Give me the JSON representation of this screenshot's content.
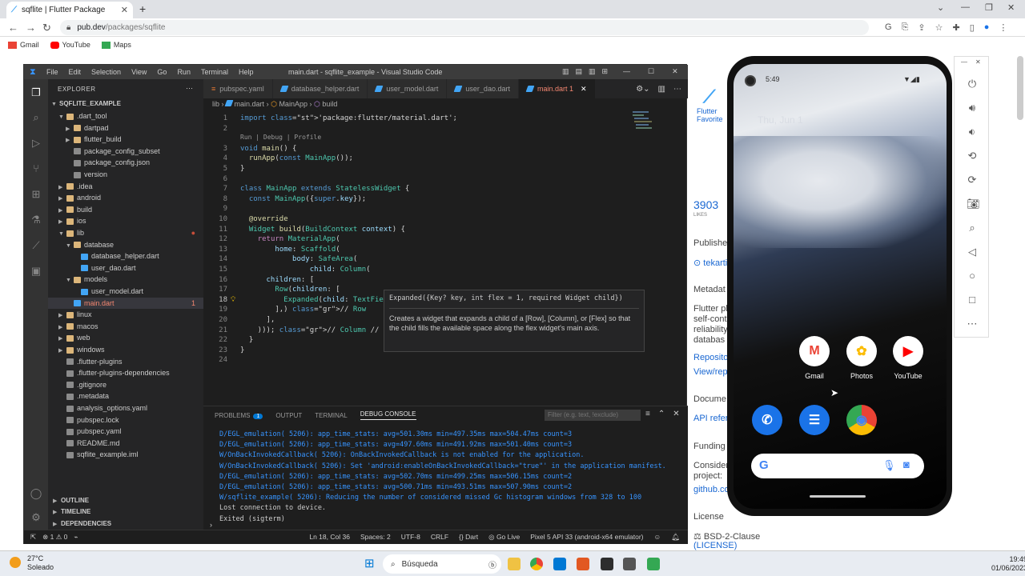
{
  "browser": {
    "tab_title": "sqflite | Flutter Package",
    "url_domain": "pub.dev",
    "url_path": "/packages/sqflite",
    "bookmarks": [
      "Gmail",
      "YouTube",
      "Maps"
    ]
  },
  "webpage": {
    "flutter_badge": "Flutter Favorite",
    "likes_count": "3903",
    "likes_label": "LIKES",
    "publisher_label": "Publishe",
    "publisher_value": "tekarti",
    "metadata_label": "Metadat",
    "desc_lines": [
      "Flutter pl",
      "self-cont",
      "reliability",
      "databas"
    ],
    "repo_link": "Reposito",
    "view_link": "View/rep",
    "docs_label": "Docume",
    "api_link": "API refer",
    "funding_label": "Funding",
    "consider_lines": [
      "Consider",
      "project:"
    ],
    "github_link": "github.co",
    "license_label": "License",
    "license_value": "BSD-2-Clause",
    "license_link": "(LICENSE)"
  },
  "vscode": {
    "menu": [
      "File",
      "Edit",
      "Selection",
      "View",
      "Go",
      "Run",
      "Terminal",
      "Help"
    ],
    "title": "main.dart - sqflite_example - Visual Studio Code",
    "explorer_label": "EXPLORER",
    "root_folder": "SQFLITE_EXAMPLE",
    "tree": [
      {
        "label": ".dart_tool",
        "depth": 1,
        "type": "folder-open"
      },
      {
        "label": "dartpad",
        "depth": 2,
        "type": "folder"
      },
      {
        "label": "flutter_build",
        "depth": 2,
        "type": "folder"
      },
      {
        "label": "package_config_subset",
        "depth": 2,
        "type": "file"
      },
      {
        "label": "package_config.json",
        "depth": 2,
        "type": "file"
      },
      {
        "label": "version",
        "depth": 2,
        "type": "file"
      },
      {
        "label": ".idea",
        "depth": 1,
        "type": "folder"
      },
      {
        "label": "android",
        "depth": 1,
        "type": "folder"
      },
      {
        "label": "build",
        "depth": 1,
        "type": "folder"
      },
      {
        "label": "ios",
        "depth": 1,
        "type": "folder"
      },
      {
        "label": "lib",
        "depth": 1,
        "type": "folder-open"
      },
      {
        "label": "database",
        "depth": 2,
        "type": "folder-open"
      },
      {
        "label": "database_helper.dart",
        "depth": 3,
        "type": "dart"
      },
      {
        "label": "user_dao.dart",
        "depth": 3,
        "type": "dart"
      },
      {
        "label": "models",
        "depth": 2,
        "type": "folder-open"
      },
      {
        "label": "user_model.dart",
        "depth": 3,
        "type": "dart"
      },
      {
        "label": "main.dart",
        "depth": 2,
        "type": "dart",
        "selected": true,
        "badge": "1"
      },
      {
        "label": "linux",
        "depth": 1,
        "type": "folder"
      },
      {
        "label": "macos",
        "depth": 1,
        "type": "folder"
      },
      {
        "label": "web",
        "depth": 1,
        "type": "folder"
      },
      {
        "label": "windows",
        "depth": 1,
        "type": "folder"
      },
      {
        "label": ".flutter-plugins",
        "depth": 1,
        "type": "file"
      },
      {
        "label": ".flutter-plugins-dependencies",
        "depth": 1,
        "type": "file"
      },
      {
        "label": ".gitignore",
        "depth": 1,
        "type": "file"
      },
      {
        "label": ".metadata",
        "depth": 1,
        "type": "file"
      },
      {
        "label": "analysis_options.yaml",
        "depth": 1,
        "type": "file"
      },
      {
        "label": "pubspec.lock",
        "depth": 1,
        "type": "file"
      },
      {
        "label": "pubspec.yaml",
        "depth": 1,
        "type": "file"
      },
      {
        "label": "README.md",
        "depth": 1,
        "type": "file"
      },
      {
        "label": "sqflite_example.iml",
        "depth": 1,
        "type": "file"
      }
    ],
    "outline_sections": [
      "OUTLINE",
      "TIMELINE",
      "DEPENDENCIES"
    ],
    "tabs": [
      "pubspec.yaml",
      "database_helper.dart",
      "user_model.dart",
      "user_dao.dart",
      "main.dart 1"
    ],
    "breadcrumb": [
      "lib",
      "main.dart",
      "MainApp",
      "build"
    ],
    "codelens": "Run | Debug | Profile",
    "code_lines": [
      "import 'package:flutter/material.dart';",
      "",
      "void main() {",
      "  runApp(const MainApp());",
      "}",
      "",
      "class MainApp extends StatelessWidget {",
      "  const MainApp({super.key});",
      "",
      "  @override",
      "  Widget build(BuildContext context) {",
      "    return MaterialApp(",
      "        home: Scaffold(",
      "            body: SafeArea(",
      "                child: Column(",
      "      children: [",
      "        Row(children: [",
      "          Expanded(child: TextField)",
      "        ],) // Row",
      "      ],",
      "    ))); // Column // SafeArea // Scaffold // MaterialApp",
      "  }",
      "}",
      ""
    ],
    "hover_signature": "Expanded({Key? key, int flex = 1, required Widget child})",
    "hover_doc": "Creates a widget that expands a child of a [Row], [Column], or [Flex] so that the child fills the available space along the flex widget's main axis.",
    "panel_tabs": [
      "PROBLEMS",
      "OUTPUT",
      "TERMINAL",
      "DEBUG CONSOLE"
    ],
    "problems_count": "1",
    "filter_placeholder": "Filter (e.g. text, !exclude)",
    "console_lines": [
      "D/EGL_emulation( 5206): app_time_stats: avg=501.30ms min=497.35ms max=504.47ms count=3",
      "D/EGL_emulation( 5206): app_time_stats: avg=497.60ms min=491.92ms max=501.40ms count=3",
      "W/OnBackInvokedCallback( 5206): OnBackInvokedCallback is not enabled for the application.",
      "W/OnBackInvokedCallback( 5206): Set 'android:enableOnBackInvokedCallback=\"true\"' in the application manifest.",
      "D/EGL_emulation( 5206): app_time_stats: avg=502.70ms min=499.25ms max=506.15ms count=2",
      "D/EGL_emulation( 5206): app_time_stats: avg=500.71ms min=493.51ms max=507.90ms count=2",
      "W/sqflite_example( 5206): Reducing the number of considered missed Gc histogram windows from 328 to 100",
      "Lost connection to device.",
      "Exited (sigterm)"
    ],
    "status_left": "⊗ 1 ⚠ 0",
    "status_items": [
      "Ln 18, Col 36",
      "Spaces: 2",
      "UTF-8",
      "CRLF",
      "{} Dart",
      "Go Live",
      "Pixel 5 API 33 (android-x64 emulator)"
    ]
  },
  "phone": {
    "time": "5:49",
    "date": "Thu, Jun 1",
    "apps_row1": [
      {
        "label": "Gmail",
        "icon": "gmail-icon",
        "color": "#ea4335",
        "glyph": "M"
      },
      {
        "label": "Photos",
        "icon": "photos-icon",
        "color": "#fbbc04",
        "glyph": "✿"
      },
      {
        "label": "YouTube",
        "icon": "youtube-icon",
        "color": "#ff0000",
        "glyph": "▶"
      }
    ],
    "apps_row2": [
      {
        "icon": "phone-icon",
        "color": "#1a73e8",
        "glyph": "✆"
      },
      {
        "icon": "messages-icon",
        "color": "#1a73e8",
        "glyph": "☰"
      },
      {
        "icon": "chrome-icon",
        "color": "#34a853",
        "glyph": "◉"
      }
    ]
  },
  "taskbar": {
    "weather_temp": "27°C",
    "weather_desc": "Soleado",
    "search_label": "Búsqueda",
    "time": "19:49",
    "date": "01/06/2023"
  }
}
